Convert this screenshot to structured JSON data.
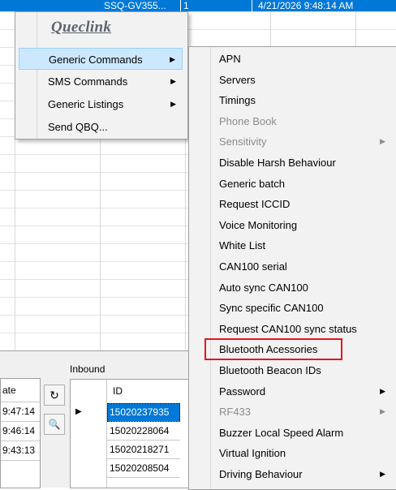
{
  "top_row": {
    "device": "SSQ-GV355...",
    "count": "1",
    "datetime": "4/21/2026 9:48:14 AM"
  },
  "menu": {
    "logo": "Queclink",
    "items": [
      {
        "label": "Generic Commands",
        "arrow": "▶"
      },
      {
        "label": "SMS Commands",
        "arrow": "▶"
      },
      {
        "label": "Generic Listings",
        "arrow": "▶"
      },
      {
        "label": "Send QBQ...",
        "arrow": ""
      }
    ]
  },
  "submenu": {
    "items": [
      {
        "label": "APN",
        "arrow": ""
      },
      {
        "label": "Servers",
        "arrow": ""
      },
      {
        "label": "Timings",
        "arrow": ""
      },
      {
        "label": "Phone Book",
        "arrow": ""
      },
      {
        "label": "Sensitivity",
        "arrow": "▶"
      },
      {
        "label": "Disable Harsh Behaviour",
        "arrow": ""
      },
      {
        "label": "Generic batch",
        "arrow": ""
      },
      {
        "label": "Request ICCID",
        "arrow": ""
      },
      {
        "label": "Voice Monitoring",
        "arrow": ""
      },
      {
        "label": "White List",
        "arrow": ""
      },
      {
        "label": "CAN100 serial",
        "arrow": ""
      },
      {
        "label": "Auto sync CAN100",
        "arrow": ""
      },
      {
        "label": "Sync specific CAN100",
        "arrow": ""
      },
      {
        "label": "Request CAN100 sync status",
        "arrow": ""
      },
      {
        "label": "Bluetooth Acessories",
        "arrow": ""
      },
      {
        "label": "Bluetooth Beacon IDs",
        "arrow": ""
      },
      {
        "label": "Password",
        "arrow": "▶"
      },
      {
        "label": "RF433",
        "arrow": "▶"
      },
      {
        "label": "Buzzer Local Speed Alarm",
        "arrow": ""
      },
      {
        "label": "Virtual Ignition",
        "arrow": ""
      },
      {
        "label": "Driving Behaviour",
        "arrow": "▶"
      }
    ]
  },
  "left_grid": {
    "header": "ate",
    "times": [
      "9:47:14",
      "9:46:14",
      "9:43:13"
    ]
  },
  "inbound": {
    "label": "Inbound",
    "column_id": "ID",
    "ids": [
      "15020237935",
      "15020228064",
      "15020218271",
      "15020208504"
    ],
    "selected_index": 0,
    "row_indicator": "▶"
  },
  "tools": {
    "refresh_glyph": "↻",
    "zoom_glyph": "🔍"
  },
  "colors": {
    "selection": "#0078d7",
    "menu_highlight": "#cce8ff",
    "annotation_box": "#e8141e"
  }
}
